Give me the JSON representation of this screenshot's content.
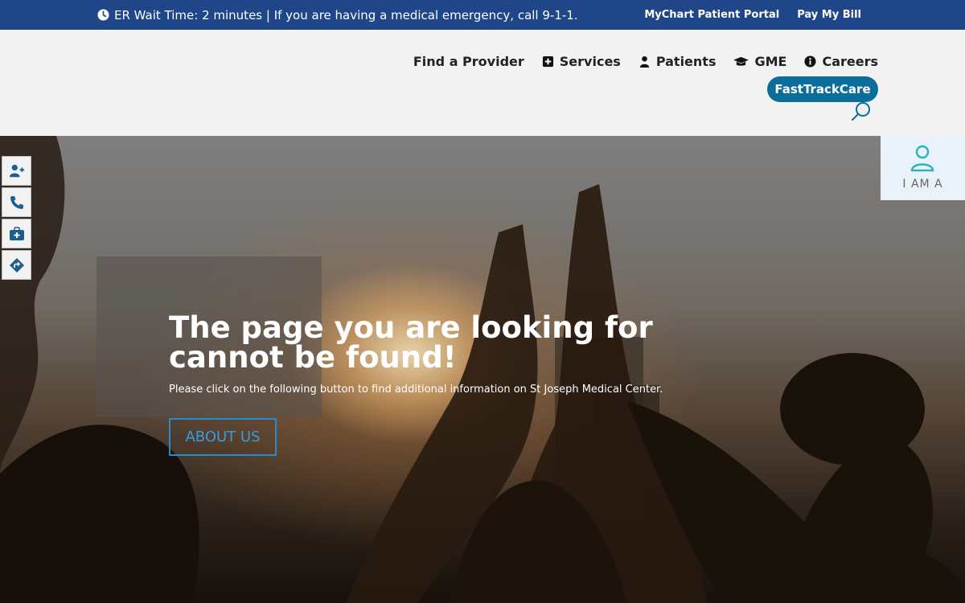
{
  "topbar": {
    "er_wait": "ER Wait Time: 2 minutes | If you are having a medical emergency, call 9-1-1.",
    "links": [
      "MyChart Patient Portal",
      "Pay My Bill"
    ]
  },
  "nav": {
    "items": [
      "Find a Provider",
      "Services",
      "Patients",
      "GME",
      "Careers"
    ],
    "cta": "FastTrackCare"
  },
  "hero": {
    "title": "The page you are looking for cannot be found!",
    "subtitle": "Please click on the following button to find additional information on St Joseph Medical Center.",
    "button": "ABOUT US"
  },
  "side_icons": [
    "add-user-icon",
    "phone-icon",
    "medical-kit-icon",
    "directions-icon"
  ],
  "iama": {
    "label": "I AM A"
  },
  "colors": {
    "topbar_bg": "#1f4688",
    "cta_bg": "#0b6e9a",
    "button_border": "#2a8ad0",
    "iama_icon": "#2bb3c0"
  }
}
